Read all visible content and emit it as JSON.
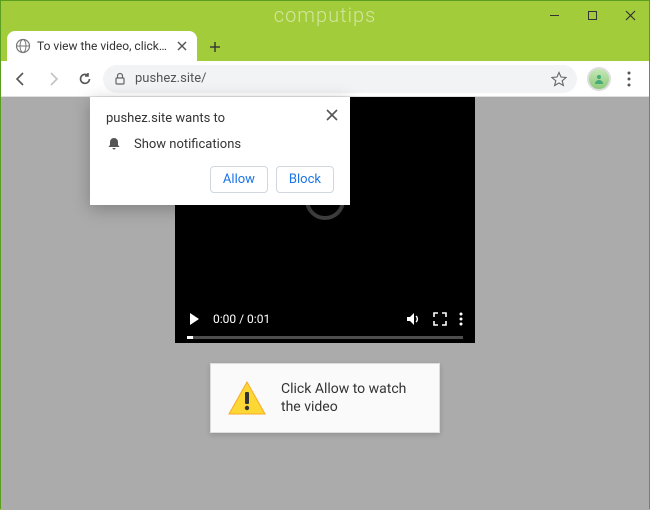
{
  "window": {
    "watermark": "computips"
  },
  "tab": {
    "title": "To view the video, click the Allow"
  },
  "toolbar": {
    "url": "pushez.site/"
  },
  "notification": {
    "prompt": "pushez.site wants to",
    "permission_label": "Show notifications",
    "allow_label": "Allow",
    "block_label": "Block"
  },
  "video": {
    "time": "0:00 / 0:01"
  },
  "card": {
    "message": "Click Allow to watch the video"
  }
}
